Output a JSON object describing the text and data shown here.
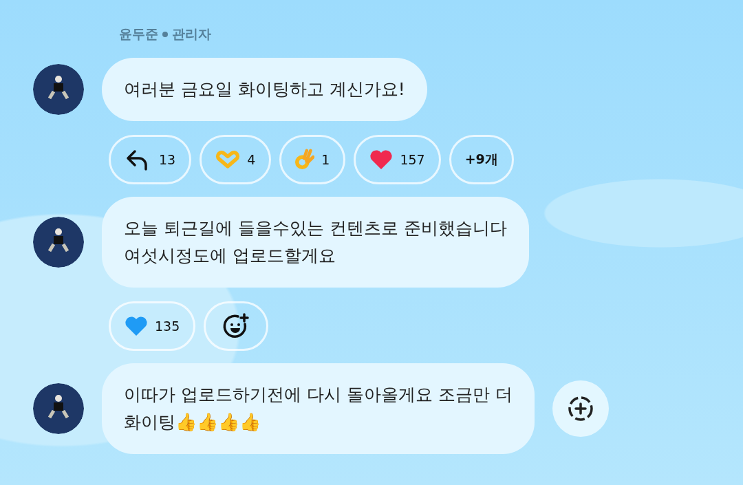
{
  "sender": {
    "name": "윤두준",
    "role": "관리자"
  },
  "messages": [
    {
      "text": "여러분 금요일 화이팅하고 계신가요!",
      "reactions": [
        {
          "kind": "reply",
          "count": "13"
        },
        {
          "kind": "hands",
          "count": "4"
        },
        {
          "kind": "ok",
          "count": "1"
        },
        {
          "kind": "heart",
          "color": "#f0294f",
          "count": "157"
        },
        {
          "kind": "more",
          "count": "+9개"
        }
      ]
    },
    {
      "text": "오늘 퇴근길에 들을수있는 컨텐츠로 준비했습니다\n여섯시정도에 업로드할게요",
      "reactions": [
        {
          "kind": "heart",
          "color": "#1f9bf5",
          "count": "135"
        },
        {
          "kind": "add"
        }
      ]
    },
    {
      "text": "이따가 업로드하기전에 다시 돌아올게요 조금만 더\n화이팅👍👍👍👍",
      "side_button": true
    }
  ]
}
